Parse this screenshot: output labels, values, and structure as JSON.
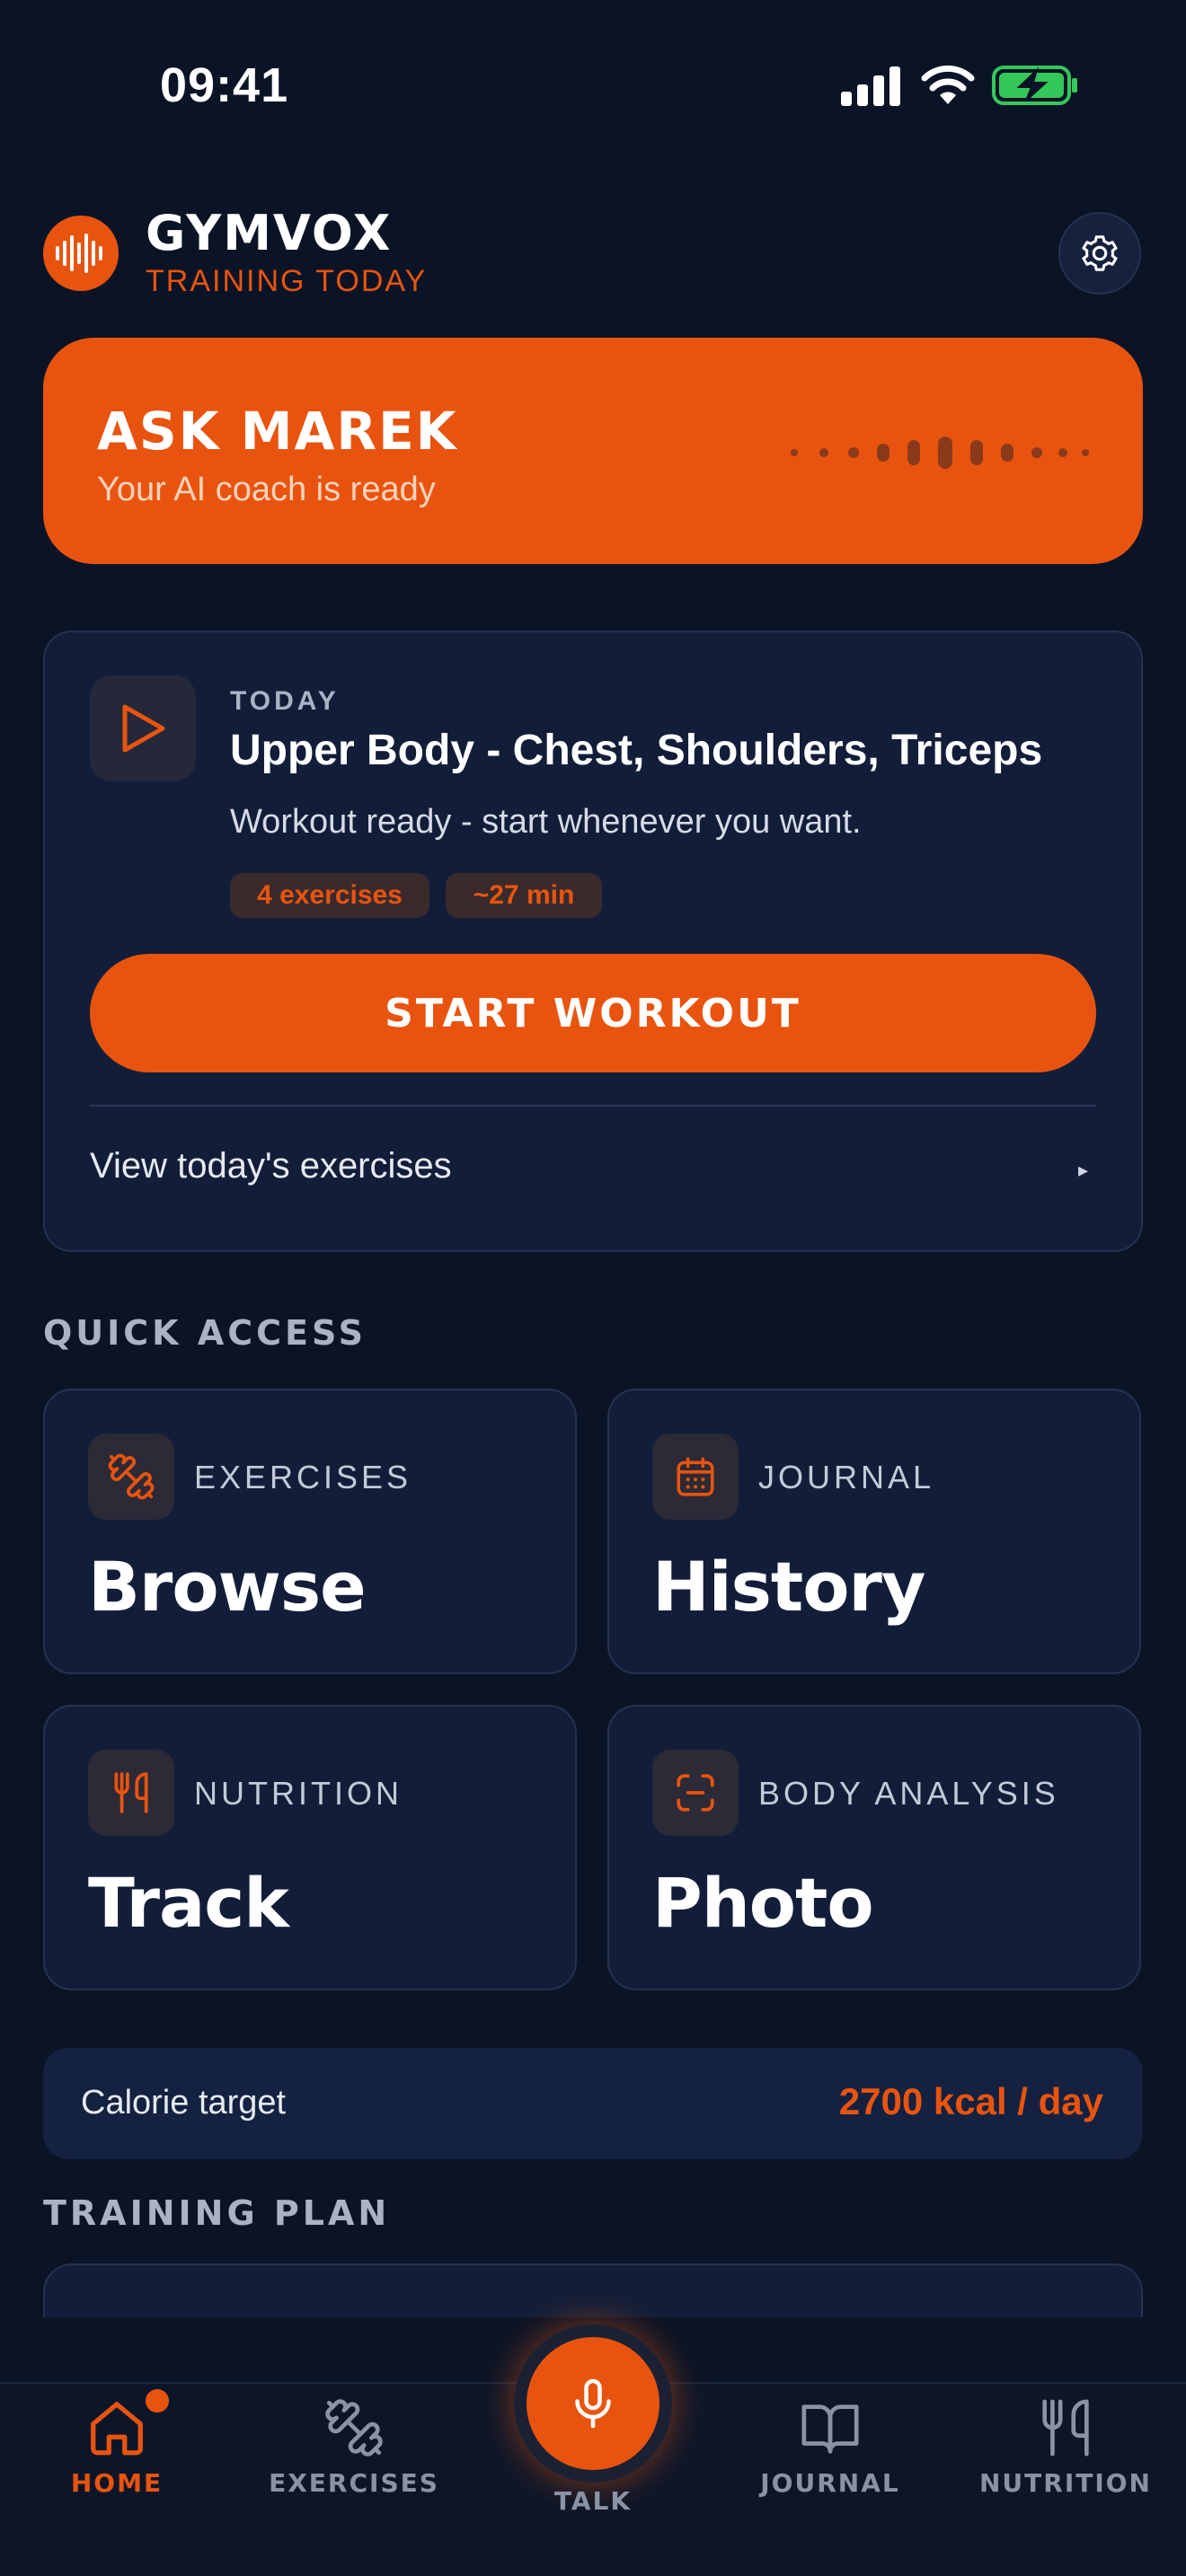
{
  "status_bar": {
    "time": "09:41"
  },
  "header": {
    "app_name": "GYMVOX",
    "subtitle": "TRAINING TODAY"
  },
  "ask_card": {
    "title": "ASK MAREK",
    "subtitle": "Your AI coach is ready"
  },
  "today": {
    "label": "TODAY",
    "title": "Upper Body - Chest, Shoulders, Triceps",
    "description": "Workout ready - start whenever you want.",
    "chips": [
      "4 exercises",
      "~27 min"
    ],
    "start_button": "START WORKOUT",
    "view_link": "View today's exercises",
    "view_arrow": "▸"
  },
  "quick_access": {
    "label": "QUICK ACCESS",
    "tiles": [
      {
        "caption": "EXERCISES",
        "title": "Browse",
        "icon": "dumbbell-icon"
      },
      {
        "caption": "JOURNAL",
        "title": "History",
        "icon": "calendar-icon"
      },
      {
        "caption": "NUTRITION",
        "title": "Track",
        "icon": "utensils-icon"
      },
      {
        "caption": "BODY ANALYSIS",
        "title": "Photo",
        "icon": "scan-icon"
      }
    ]
  },
  "calorie": {
    "label": "Calorie target",
    "value": "2700 kcal / day"
  },
  "training_plan": {
    "label": "TRAINING PLAN"
  },
  "nav": {
    "items": [
      {
        "label": "HOME",
        "icon": "home-icon",
        "active": true
      },
      {
        "label": "EXERCISES",
        "icon": "dumbbell-icon"
      },
      {
        "label": "TALK",
        "icon": "microphone-icon"
      },
      {
        "label": "JOURNAL",
        "icon": "book-icon"
      },
      {
        "label": "NUTRITION",
        "icon": "utensils-icon"
      }
    ]
  },
  "colors": {
    "accent": "#e8540f",
    "background": "#0b1426",
    "card": "#121e39",
    "battery_green": "#34c759"
  }
}
